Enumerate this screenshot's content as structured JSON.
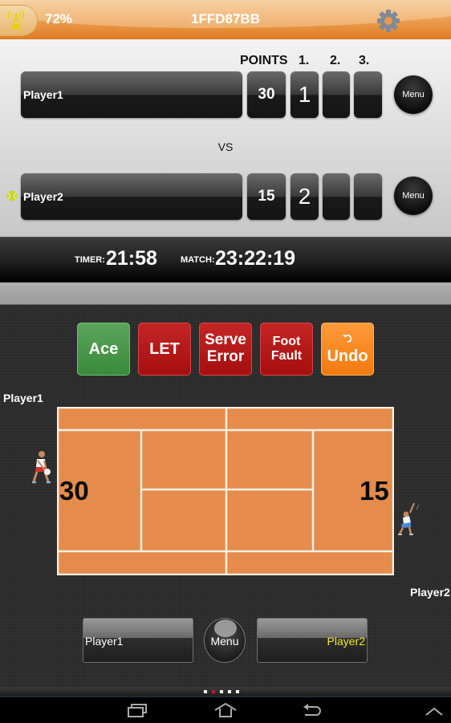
{
  "status_bar": {
    "battery": "72%",
    "device_id": "1FFD87BB",
    "signal_icon": "radio-tower-icon",
    "settings_icon": "gear-icon"
  },
  "scoreboard": {
    "headers": {
      "points": "POINTS",
      "set1": "1.",
      "set2": "2.",
      "set3": "3."
    },
    "vs": "VS",
    "players": [
      {
        "name": "Player1",
        "points": "30",
        "sets": [
          "1",
          "",
          ""
        ],
        "serving": false,
        "menu": "Menu"
      },
      {
        "name": "Player2",
        "points": "15",
        "sets": [
          "2",
          "",
          ""
        ],
        "serving": true,
        "menu": "Menu"
      }
    ]
  },
  "timers": {
    "timer_label": "TIMER:",
    "timer_value": "21:58",
    "match_label": "MATCH:",
    "match_value": "23:22:19"
  },
  "actions": [
    {
      "label": "Ace",
      "color": "#4a984a"
    },
    {
      "label": "LET",
      "color": "#b51a1a"
    },
    {
      "label": "Serve Error",
      "line1": "Serve",
      "line2": "Error",
      "color": "#b51a1a"
    },
    {
      "label": "Foot Fault",
      "line1": "Foot",
      "line2": "Fault",
      "color": "#b51a1a"
    },
    {
      "label": "Undo",
      "color": "#f58a20",
      "icon": "undo-icon"
    }
  ],
  "court": {
    "player1_label": "Player1",
    "player2_label": "Player2",
    "player1_score": "30",
    "player2_score": "15",
    "surface_color": "#e58c4c",
    "line_color": "#f8efe4"
  },
  "bottom_controls": {
    "player1": "Player1",
    "menu": "Menu",
    "player2": "Player2",
    "player2_color": "#f2ea2a"
  },
  "pager": {
    "count": 5,
    "active_index": 1,
    "active_color": "#b81e2a"
  },
  "nav": {
    "recents": "recent-apps-icon",
    "home": "home-icon",
    "back": "back-icon",
    "up": "chevron-up-icon"
  }
}
